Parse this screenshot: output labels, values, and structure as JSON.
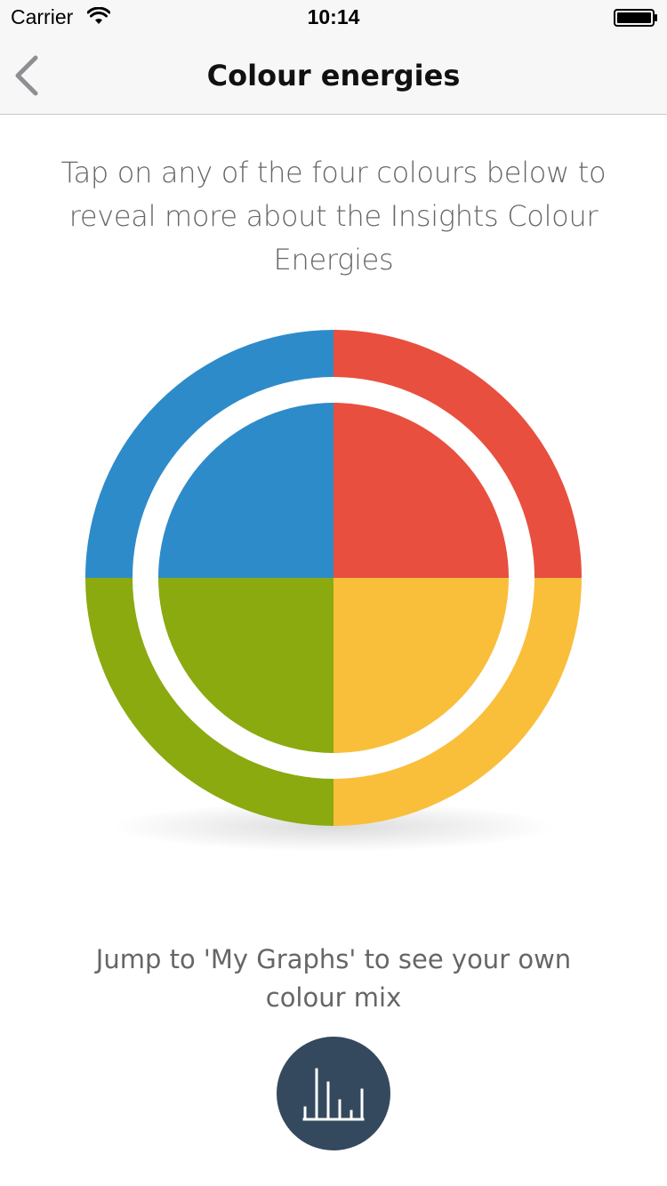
{
  "status_bar": {
    "carrier": "Carrier",
    "time": "10:14",
    "wifi_icon": "wifi-icon",
    "battery_icon": "battery-icon"
  },
  "nav": {
    "title": "Colour energies",
    "back_icon": "chevron-left-icon"
  },
  "intro_text": "Tap on any of the four colours below to reveal more about the Insights Colour Energies",
  "colour_wheel": {
    "quadrants": [
      {
        "name": "blue",
        "color": "#2e8bc9"
      },
      {
        "name": "red",
        "color": "#e84f3f"
      },
      {
        "name": "yellow",
        "color": "#f9bf3b"
      },
      {
        "name": "green",
        "color": "#8aaa10"
      }
    ]
  },
  "jump_text": "Jump to 'My Graphs' to see your own colour mix",
  "graphs_button": {
    "icon": "bar-chart-icon",
    "color": "#34495e"
  }
}
